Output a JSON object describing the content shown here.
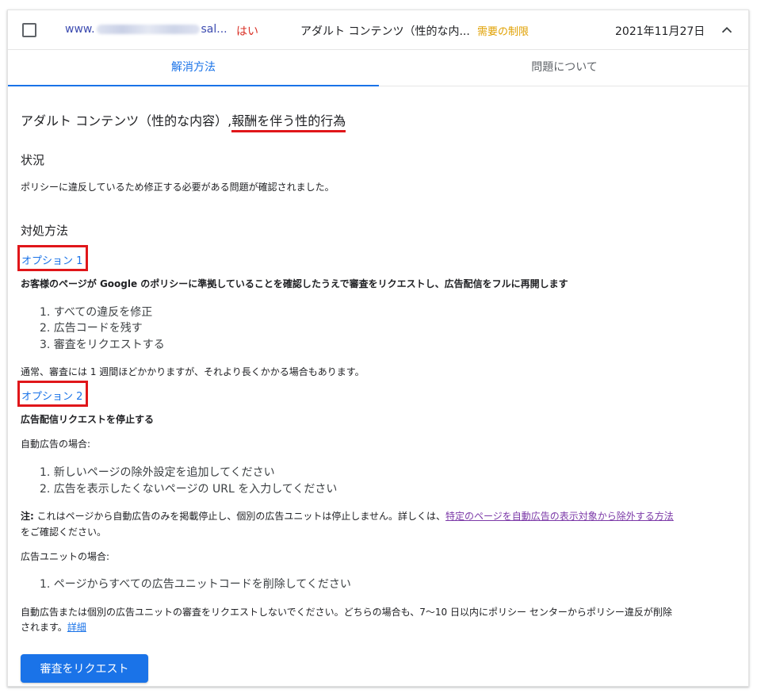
{
  "row": {
    "url_prefix": "www.",
    "url_suffix": "sal...",
    "policy_applied": "はい",
    "policy": "アダルト コンテンツ（性的な内...",
    "status": "需要の制限",
    "date": "2021年11月27日"
  },
  "tabs": {
    "resolve": "解消方法",
    "about": "問題について"
  },
  "content": {
    "heading_main": "アダルト コンテンツ（性的な内容）,",
    "heading_highlight": "報酬を伴う性的行為",
    "situation_title": "状況",
    "situation_text": "ポリシーに違反しているため修正する必要がある問題が確認されました。",
    "howto_title": "対処方法",
    "option1": {
      "label": "オプション 1",
      "title": "お客様のページが Google のポリシーに準拠していることを確認したうえで審査をリクエストし、広告配信をフルに再開します",
      "steps": [
        "1. すべての違反を修正",
        "2. 広告コードを残す",
        "3. 審査をリクエストする"
      ],
      "note": "通常、審査には 1 週間ほどかかりますが、それより長くかかる場合もあります。"
    },
    "option2": {
      "label": "オプション 2",
      "title": "広告配信リクエストを停止する",
      "auto_ads_label": "自動広告の場合:",
      "auto_steps": [
        "1. 新しいページの除外設定を追加してください",
        "2. 広告を表示したくないページの URL を入力してください"
      ],
      "note_prefix": "注:",
      "note_text": " これはページから自動広告のみを掲載停止し、個別の広告ユニットは停止しません。詳しくは、",
      "note_link": "特定のページを自動広告の表示対象から除外する方法",
      "note_end": "をご確認ください。",
      "ad_units_label": "広告ユニットの場合:",
      "unit_steps": [
        "1. ページからすべての広告ユニットコードを削除してください"
      ],
      "final_text_1": "自動広告または個別の広告ユニットの審査をリクエストしないでください。どちらの場合も、7〜10 日以内にポリシー センターからポリシー違反が削除",
      "final_text_2": "されます。",
      "details_link": "詳細"
    },
    "request_button": "審査をリクエスト"
  }
}
